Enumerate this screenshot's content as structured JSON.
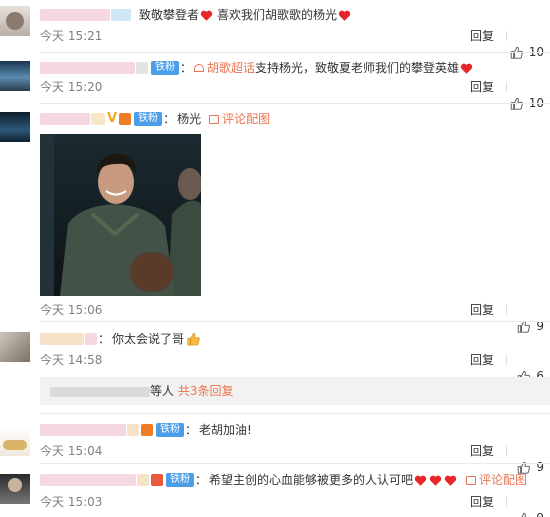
{
  "comments": [
    {
      "text": "致敬攀登者",
      "text2": "喜欢我们胡歌歌的杨光",
      "time": "今天 15:21",
      "reply": "回复",
      "likes": "10"
    },
    {
      "badge": "铁粉",
      "topic": "胡歌超话",
      "text": "支持杨光，致敬夏老师我们的攀登英雄",
      "time": "今天 15:20",
      "reply": "回复",
      "likes": "10"
    },
    {
      "badge": "铁粉",
      "text": "杨光",
      "pic_link": "评论配图",
      "time": "今天 15:06",
      "reply": "回复",
      "likes": "9"
    },
    {
      "text": "你太会说了哥",
      "time": "今天 14:58",
      "reply": "回复",
      "likes": "6",
      "subreplies_suffix": "等人",
      "subreplies_more": "共3条回复"
    },
    {
      "badge": "铁粉",
      "text": "老胡加油!",
      "time": "今天 15:04",
      "reply": "回复",
      "likes": "9"
    },
    {
      "badge": "铁粉",
      "text": "希望主创的心血能够被更多的人认可吧",
      "pic_link": "评论配图",
      "time": "今天 15:03",
      "reply": "回复",
      "likes": "9"
    }
  ],
  "colors": {
    "accent": "#eb7350",
    "badge": "#4a9ee8",
    "heart": "#e8262a",
    "time": "#808080"
  },
  "icons": {
    "like": "thumbs-up-icon",
    "heart": "heart-icon",
    "pic": "image-icon"
  }
}
